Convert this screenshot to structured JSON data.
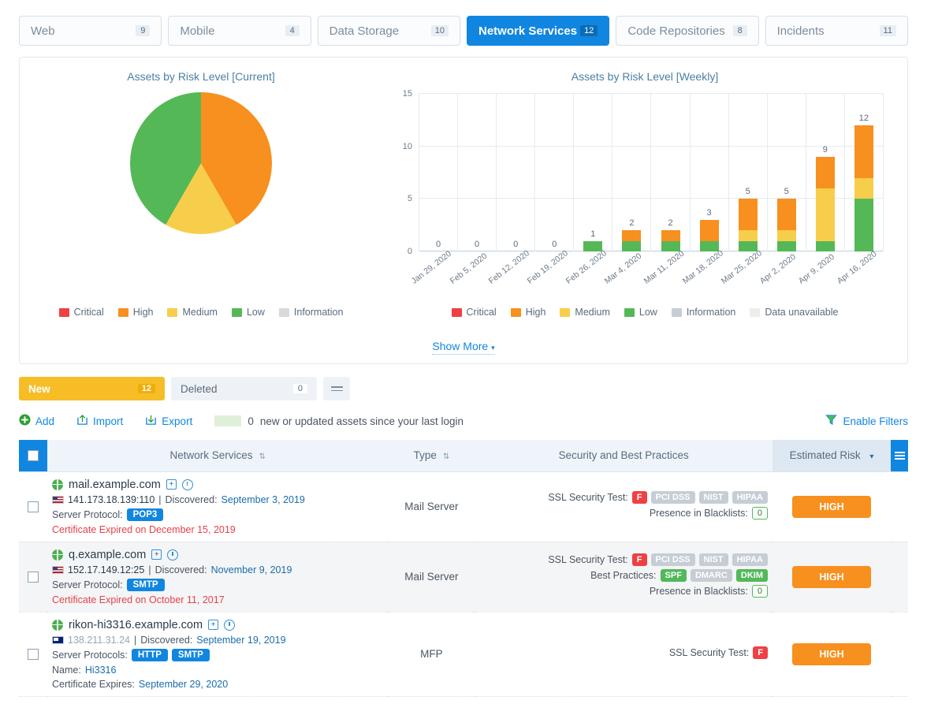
{
  "tabs": [
    {
      "label": "Web",
      "count": "9",
      "active": false
    },
    {
      "label": "Mobile",
      "count": "4",
      "active": false
    },
    {
      "label": "Data Storage",
      "count": "10",
      "active": false
    },
    {
      "label": "Network Services",
      "count": "12",
      "active": true
    },
    {
      "label": "Code Repositories",
      "count": "8",
      "active": false
    },
    {
      "label": "Incidents",
      "count": "11",
      "active": false
    }
  ],
  "charts": {
    "show_more": "Show More",
    "caret": "▾"
  },
  "chart_data": [
    {
      "type": "pie",
      "title": "Assets by Risk Level [Current]",
      "labels": [
        "Critical",
        "High",
        "Medium",
        "Low",
        "Information"
      ],
      "values": [
        0,
        5,
        2,
        5,
        0
      ],
      "percentages": [
        0,
        41.7,
        16.6,
        41.7,
        0
      ],
      "colors": [
        "#ef4044",
        "#f7901e",
        "#f7ce4b",
        "#55b857",
        "#d9d9d9"
      ],
      "legend": [
        "Critical",
        "High",
        "Medium",
        "Low",
        "Information"
      ],
      "legend_position": "bottom"
    },
    {
      "type": "bar",
      "title": "Assets by Risk Level [Weekly]",
      "stacked": true,
      "categories": [
        "Jan 29, 2020",
        "Feb 5, 2020",
        "Feb 12, 2020",
        "Feb 19, 2020",
        "Feb 26, 2020",
        "Mar 4, 2020",
        "Mar 11, 2020",
        "Mar 18, 2020",
        "Mar 25, 2020",
        "Apr 2, 2020",
        "Apr 9, 2020",
        "Apr 16, 2020"
      ],
      "totals": [
        0,
        0,
        0,
        0,
        1,
        2,
        2,
        3,
        5,
        5,
        9,
        12
      ],
      "series": [
        {
          "name": "Low",
          "color": "#55b857",
          "values": [
            0,
            0,
            0,
            0,
            1,
            1,
            1,
            1,
            1,
            1,
            1,
            5
          ]
        },
        {
          "name": "Medium",
          "color": "#f7ce4b",
          "values": [
            0,
            0,
            0,
            0,
            0,
            0,
            0,
            0,
            1,
            1,
            5,
            2
          ]
        },
        {
          "name": "High",
          "color": "#f7901e",
          "values": [
            0,
            0,
            0,
            0,
            0,
            1,
            1,
            2,
            3,
            3,
            3,
            5
          ]
        },
        {
          "name": "Critical",
          "color": "#ef4044",
          "values": [
            0,
            0,
            0,
            0,
            0,
            0,
            0,
            0,
            0,
            0,
            0,
            0
          ]
        }
      ],
      "yticks": [
        0,
        5,
        10,
        15
      ],
      "ylim": [
        0,
        15
      ],
      "xlabel": "",
      "ylabel": "",
      "grid": true,
      "legend": [
        "Critical",
        "High",
        "Medium",
        "Low",
        "Information",
        "Data unavailable"
      ],
      "legend_colors": [
        "#ef4044",
        "#f7901e",
        "#f7ce4b",
        "#55b857",
        "#c6cdd4",
        "#ededed"
      ],
      "legend_position": "bottom"
    }
  ],
  "subtabs": [
    {
      "label": "New",
      "count": "12",
      "active": true
    },
    {
      "label": "Deleted",
      "count": "0",
      "active": false
    }
  ],
  "actions": {
    "add": "Add",
    "import": "Import",
    "export": "Export",
    "new_count": "0",
    "new_text": "new or updated assets since your last login",
    "enable_filters": "Enable Filters"
  },
  "table": {
    "headers": {
      "name": "Network Services",
      "type": "Type",
      "security": "Security and Best Practices",
      "risk": "Estimated Risk",
      "risk_caret": "▾"
    },
    "rows": [
      {
        "host": "mail.example.com",
        "flag": "us",
        "ip": "141.173.18.139:110",
        "ip_muted": false,
        "discovered_label": "Discovered:",
        "discovered": "September 3, 2019",
        "protocol_label": "Server Protocol:",
        "protocols": [
          "POP3"
        ],
        "name_label": "",
        "name_value": "",
        "cert_label": "Certificate Expired on December 15, 2019",
        "cert_alert": true,
        "cert_value": "",
        "type": "Mail Server",
        "ssl_label": "SSL Security Test:",
        "ssl_grade": "F",
        "compliance": [
          {
            "label": "PCI DSS",
            "state": "grey"
          },
          {
            "label": "NIST",
            "state": "grey"
          },
          {
            "label": "HIPAA",
            "state": "grey"
          }
        ],
        "best_practices_label": "",
        "best_practices": [],
        "blacklist_label": "Presence in Blacklists:",
        "blacklist_count": "0",
        "risk": "HIGH",
        "alt": false
      },
      {
        "host": "q.example.com",
        "flag": "us",
        "ip": "152.17.149.12:25",
        "ip_muted": false,
        "discovered_label": "Discovered:",
        "discovered": "November 9, 2019",
        "protocol_label": "Server Protocol:",
        "protocols": [
          "SMTP"
        ],
        "name_label": "",
        "name_value": "",
        "cert_label": "Certificate Expired on October 11, 2017",
        "cert_alert": true,
        "cert_value": "",
        "type": "Mail Server",
        "ssl_label": "SSL Security Test:",
        "ssl_grade": "F",
        "compliance": [
          {
            "label": "PCI DSS",
            "state": "grey"
          },
          {
            "label": "NIST",
            "state": "grey"
          },
          {
            "label": "HIPAA",
            "state": "grey"
          }
        ],
        "best_practices_label": "Best Practices:",
        "best_practices": [
          {
            "label": "SPF",
            "state": "green"
          },
          {
            "label": "DMARC",
            "state": "grey"
          },
          {
            "label": "DKIM",
            "state": "green"
          }
        ],
        "blacklist_label": "Presence in Blacklists:",
        "blacklist_count": "0",
        "risk": "HIGH",
        "alt": true
      },
      {
        "host": "rikon-hi3316.example.com",
        "flag": "au",
        "ip": "138.211.31.24",
        "ip_muted": true,
        "discovered_label": "Discovered:",
        "discovered": "September 19, 2019",
        "protocol_label": "Server Protocols:",
        "protocols": [
          "HTTP",
          "SMTP"
        ],
        "name_label": "Name:",
        "name_value": "Hi3316",
        "cert_label": "Certificate Expires:",
        "cert_alert": false,
        "cert_value": "September 29, 2020",
        "type": "MFP",
        "ssl_label": "SSL Security Test:",
        "ssl_grade": "F",
        "compliance": [],
        "best_practices_label": "",
        "best_practices": [],
        "blacklist_label": "",
        "blacklist_count": "",
        "risk": "HIGH",
        "alt": false
      }
    ]
  }
}
